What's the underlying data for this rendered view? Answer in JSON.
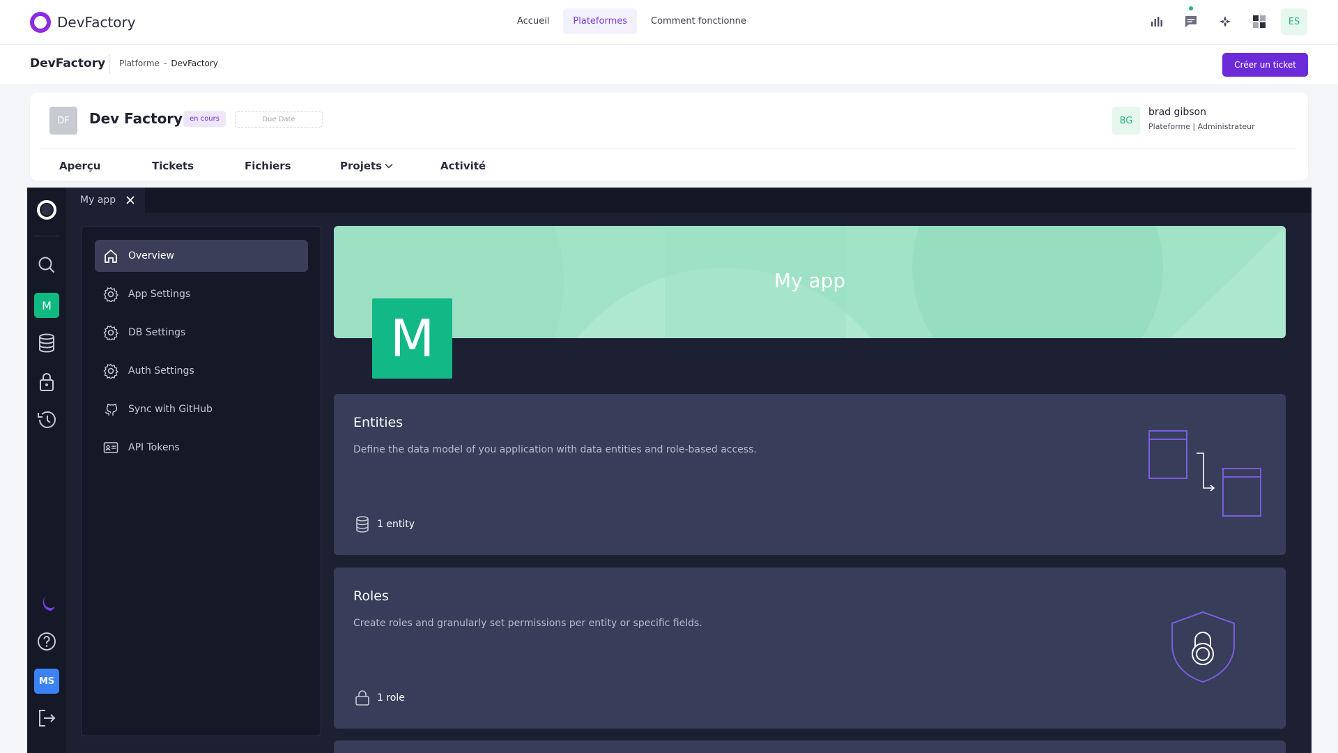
{
  "brand": {
    "name": "DevFactory"
  },
  "topnav": [
    {
      "label": "Accueil",
      "active": false
    },
    {
      "label": "Plateformes",
      "active": true
    },
    {
      "label": "Comment fonctionne",
      "active": false
    }
  ],
  "top_icons": [
    "bar-chart-icon",
    "chat-icon",
    "sparkle-icon",
    "apps-icon"
  ],
  "top_user": {
    "initials": "ES"
  },
  "subbar": {
    "title": "DevFactory",
    "breadcrumb": [
      "Platforme",
      "DevFactory"
    ],
    "breadcrumb_sep": "-",
    "create_ticket": "Créer un ticket"
  },
  "project": {
    "initials": "DF",
    "name": "Dev Factory",
    "status": "en cours",
    "due_date": "Due Date",
    "user": {
      "initials": "BG",
      "name": "brad gibson",
      "role": "Plateforme | Administrateur"
    },
    "tabs": [
      "Aperçu",
      "Tickets",
      "Fichiers",
      "Projets",
      "Activité"
    ]
  },
  "app": {
    "tab_label": "My app",
    "rail": {
      "app_initial": "M",
      "user_initials": "MS"
    },
    "settings": [
      {
        "label": "Overview",
        "icon": "home-icon",
        "active": true
      },
      {
        "label": "App Settings",
        "icon": "gear-icon",
        "active": false
      },
      {
        "label": "DB Settings",
        "icon": "gear-icon",
        "active": false
      },
      {
        "label": "Auth Settings",
        "icon": "gear-icon",
        "active": false
      },
      {
        "label": "Sync with GitHub",
        "icon": "github-icon",
        "active": false
      },
      {
        "label": "API Tokens",
        "icon": "id-card-icon",
        "active": false
      }
    ],
    "banner_title": "My app",
    "tile_initial": "M",
    "cards": [
      {
        "title": "Entities",
        "description": "Define the data model of you application with data entities and role-based access.",
        "meta": "1 entity"
      },
      {
        "title": "Roles",
        "description": "Create roles and granularly set permissions per entity or specific fields.",
        "meta": "1 role"
      }
    ]
  },
  "colors": {
    "brand": "#8b2be2",
    "primary_button": "#6c2bd9",
    "accent_green": "#10b981",
    "banner": "#a0e3c7",
    "app_bg": "#1d2033",
    "card_bg": "#383d59",
    "illustration": "#7c5ce0"
  }
}
